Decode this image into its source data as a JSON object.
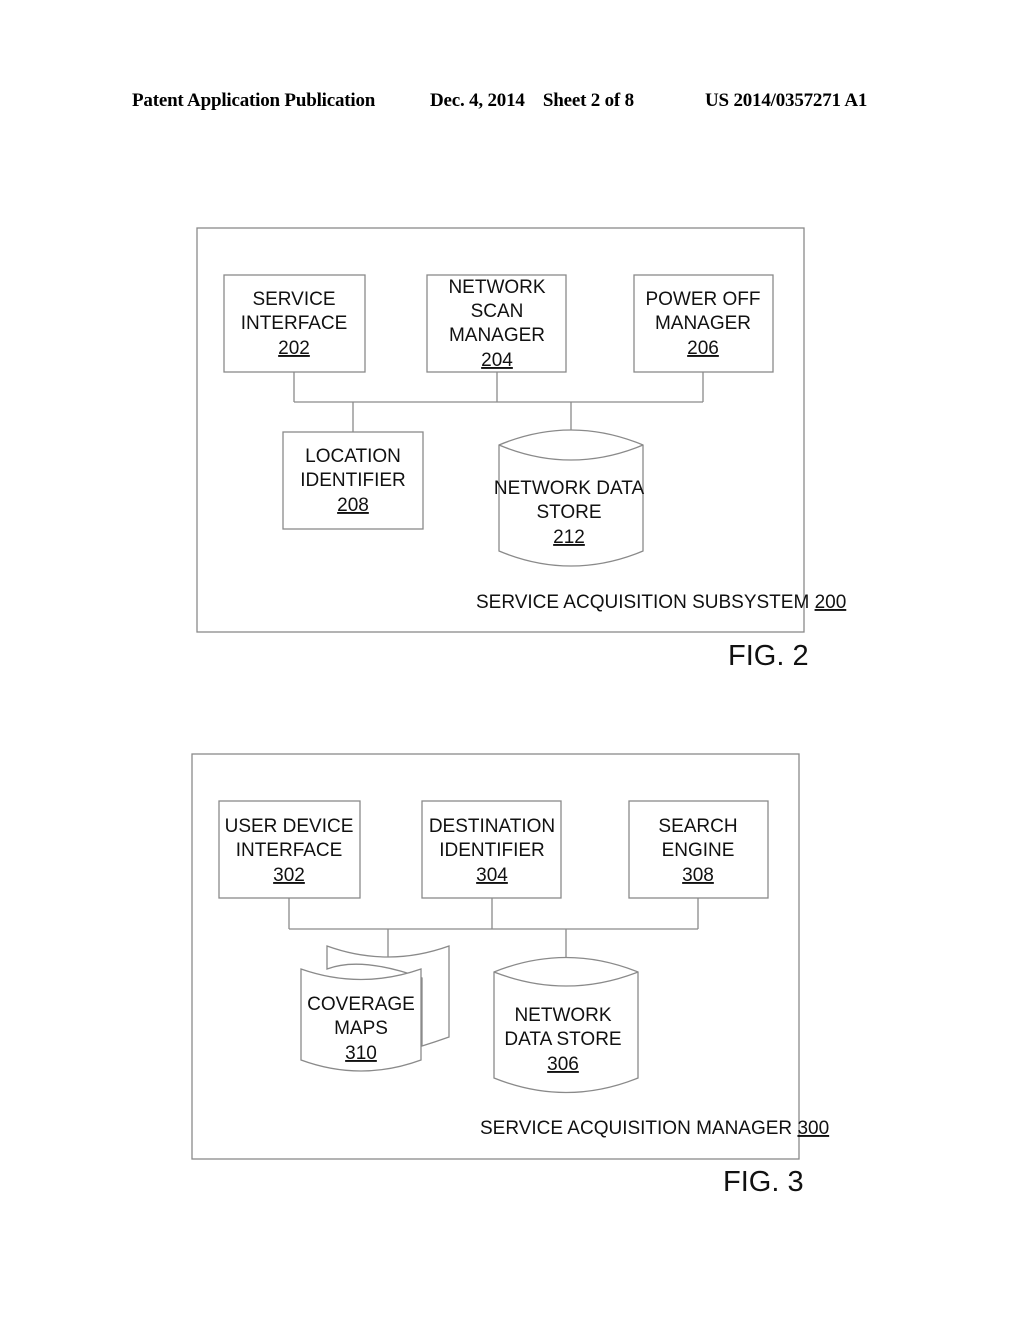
{
  "header": {
    "publication": "Patent Application Publication",
    "date_sheet": "Dec. 4, 2014    Sheet 2 of 8",
    "number": "US 2014/0357271 A1"
  },
  "fig2": {
    "caption": "FIG. 2",
    "container": {
      "label": "SERVICE ACQUISITION SUBSYSTEM",
      "ref": "200"
    },
    "nodes": [
      {
        "lines": [
          "SERVICE",
          "INTERFACE"
        ],
        "ref": "202",
        "shape": "box"
      },
      {
        "lines": [
          "NETWORK",
          "SCAN",
          "MANAGER"
        ],
        "ref": "204",
        "shape": "box"
      },
      {
        "lines": [
          "POWER OFF",
          "MANAGER"
        ],
        "ref": "206",
        "shape": "box"
      },
      {
        "lines": [
          "LOCATION",
          "IDENTIFIER"
        ],
        "ref": "208",
        "shape": "box"
      },
      {
        "lines": [
          "NETWORK DATA",
          "STORE"
        ],
        "ref": "212",
        "shape": "datastore"
      }
    ]
  },
  "fig3": {
    "caption": "FIG. 3",
    "container": {
      "label": "SERVICE ACQUISITION MANAGER",
      "ref": "300"
    },
    "nodes": [
      {
        "lines": [
          "USER DEVICE",
          "INTERFACE"
        ],
        "ref": "302",
        "shape": "box"
      },
      {
        "lines": [
          "DESTINATION",
          "IDENTIFIER"
        ],
        "ref": "304",
        "shape": "box"
      },
      {
        "lines": [
          "SEARCH",
          "ENGINE"
        ],
        "ref": "308",
        "shape": "box"
      },
      {
        "lines": [
          "COVERAGE",
          "MAPS"
        ],
        "ref": "310",
        "shape": "multi-document"
      },
      {
        "lines": [
          "NETWORK",
          "DATA STORE"
        ],
        "ref": "306",
        "shape": "datastore"
      }
    ]
  }
}
